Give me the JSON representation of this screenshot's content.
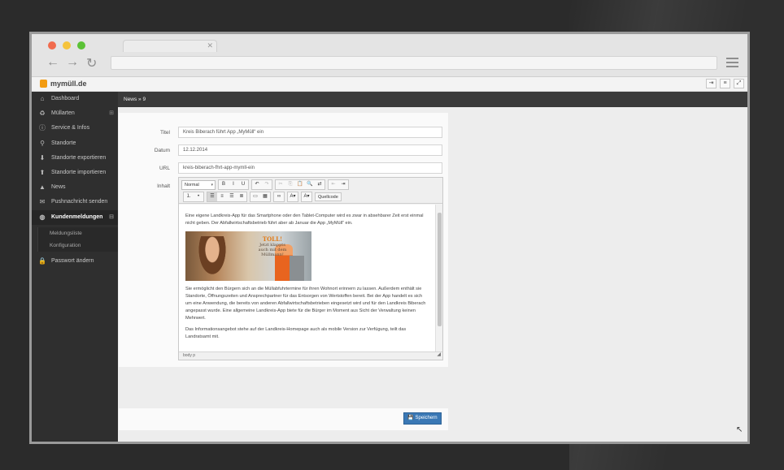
{
  "app": {
    "logo_text": "mymüll.de"
  },
  "browser": {
    "tab_close": "✕",
    "nav": {
      "back": "←",
      "forward": "→",
      "reload": "↻"
    }
  },
  "header_buttons": [
    {
      "icon": "logout-icon",
      "glyph": "⇥"
    },
    {
      "icon": "list-icon",
      "glyph": "≡"
    },
    {
      "icon": "fullscreen-icon",
      "glyph": "⤢"
    }
  ],
  "sidebar": {
    "items": [
      {
        "label": "Dashboard",
        "icon": "home-icon",
        "glyph": "⌂"
      },
      {
        "label": "Müllarten",
        "icon": "recycle-icon",
        "glyph": "♻",
        "badge": "⊞"
      },
      {
        "label": "Service & Infos",
        "icon": "info-icon",
        "glyph": "ⓘ"
      },
      {
        "label": "Standorte",
        "icon": "map-marker-icon",
        "glyph": "⚲"
      },
      {
        "label": "Standorte exportieren",
        "icon": "download-icon",
        "glyph": "⬇"
      },
      {
        "label": "Standorte importieren",
        "icon": "upload-icon",
        "glyph": "⬆"
      },
      {
        "label": "News",
        "icon": "warning-icon",
        "glyph": "▲"
      },
      {
        "label": "Pushnachricht senden",
        "icon": "bullhorn-icon",
        "glyph": "✉"
      },
      {
        "label": "Kundenmeldungen",
        "icon": "globe-icon",
        "glyph": "◍",
        "badge": "⊟"
      }
    ],
    "subitems": [
      {
        "label": "Meldungsliste"
      },
      {
        "label": "Konfiguration"
      }
    ],
    "after": {
      "label": "Passwort ändern",
      "icon": "lock-icon",
      "glyph": "🔒"
    }
  },
  "breadcrumb": {
    "text": "News » 9"
  },
  "form": {
    "titel_label": "Titel",
    "titel_value": "Kreis Biberach führt App „MyMüll“ ein",
    "datum_label": "Datum",
    "datum_value": "12.12.2014",
    "url_label": "URL",
    "url_value": "kreis-biberach-fhrt-app-mymll-ein",
    "inhalt_label": "Inhalt",
    "save_label": "Speichern"
  },
  "editor": {
    "format_select": "Normal",
    "source_label": "Quellcode",
    "toolbar_row1": [
      {
        "name": "bold-button",
        "glyph": "B"
      },
      {
        "name": "italic-button",
        "glyph": "I"
      },
      {
        "name": "underline-button",
        "glyph": "U"
      },
      {
        "name": "undo-button",
        "glyph": "↶"
      },
      {
        "name": "redo-button",
        "glyph": "↷",
        "dim": true
      },
      {
        "name": "cut-button",
        "glyph": "✂",
        "dim": true
      },
      {
        "name": "copy-button",
        "glyph": "⎘",
        "dim": true
      },
      {
        "name": "paste-button",
        "glyph": "📋"
      },
      {
        "name": "find-button",
        "glyph": "🔍"
      },
      {
        "name": "replace-button",
        "glyph": "⇄"
      },
      {
        "name": "outdent-button",
        "glyph": "⇤",
        "dim": true
      },
      {
        "name": "indent-button",
        "glyph": "⇥"
      }
    ],
    "toolbar_row2": [
      {
        "name": "numbered-list-button",
        "glyph": "⒈"
      },
      {
        "name": "bullet-list-button",
        "glyph": "•"
      },
      {
        "name": "align-left-button",
        "glyph": "☰",
        "on": true
      },
      {
        "name": "align-center-button",
        "glyph": "≡"
      },
      {
        "name": "align-right-button",
        "glyph": "☰"
      },
      {
        "name": "justify-button",
        "glyph": "≣"
      },
      {
        "name": "image-button",
        "glyph": "▭"
      },
      {
        "name": "table-button",
        "glyph": "▦"
      },
      {
        "name": "link-button",
        "glyph": "∞"
      },
      {
        "name": "text-color-button",
        "glyph": "A▾"
      },
      {
        "name": "bg-color-button",
        "glyph": "A▾"
      }
    ],
    "paragraph1": "Eine eigene Landkreis-App für das Smartphone oder den Tablet-Computer wird es zwar in absehbarer Zeit erst einmal nicht geben. Der Abfallwirtschaftsbetrieb führt aber ab Januar die App „MyMüll“ ein.",
    "image_text_top": "TOLL!",
    "image_text_1": "Jetzt klappts",
    "image_text_2": "auch mit dem",
    "image_text_3": "Müllmann!",
    "paragraph2": "Sie ermöglicht den Bürgern sich an die Müllabfuhrtermine für ihren Wohnort erinnern zu lassen. Außerdem enthält sie Standorte, Öffnungszeiten und Ansprechpartner für das Entsorgen von Wertstoffen bereit. Bei der App handelt es sich um eine Anwendung, die bereits von anderen Abfallwirtschaftsbetrieben eingesetzt wird und für den Landkreis Biberach angepasst wurde. Eine allgemeine Landkreis-App biete für die Bürger im Moment aus Sicht der Verwaltung keinen Mehrwert.",
    "paragraph3": "Das Informationsangebot stehe auf der Landkreis-Homepage auch als mobile Version zur Verfügung, teilt das Landratsamt mit.",
    "status_path": "body  p"
  }
}
